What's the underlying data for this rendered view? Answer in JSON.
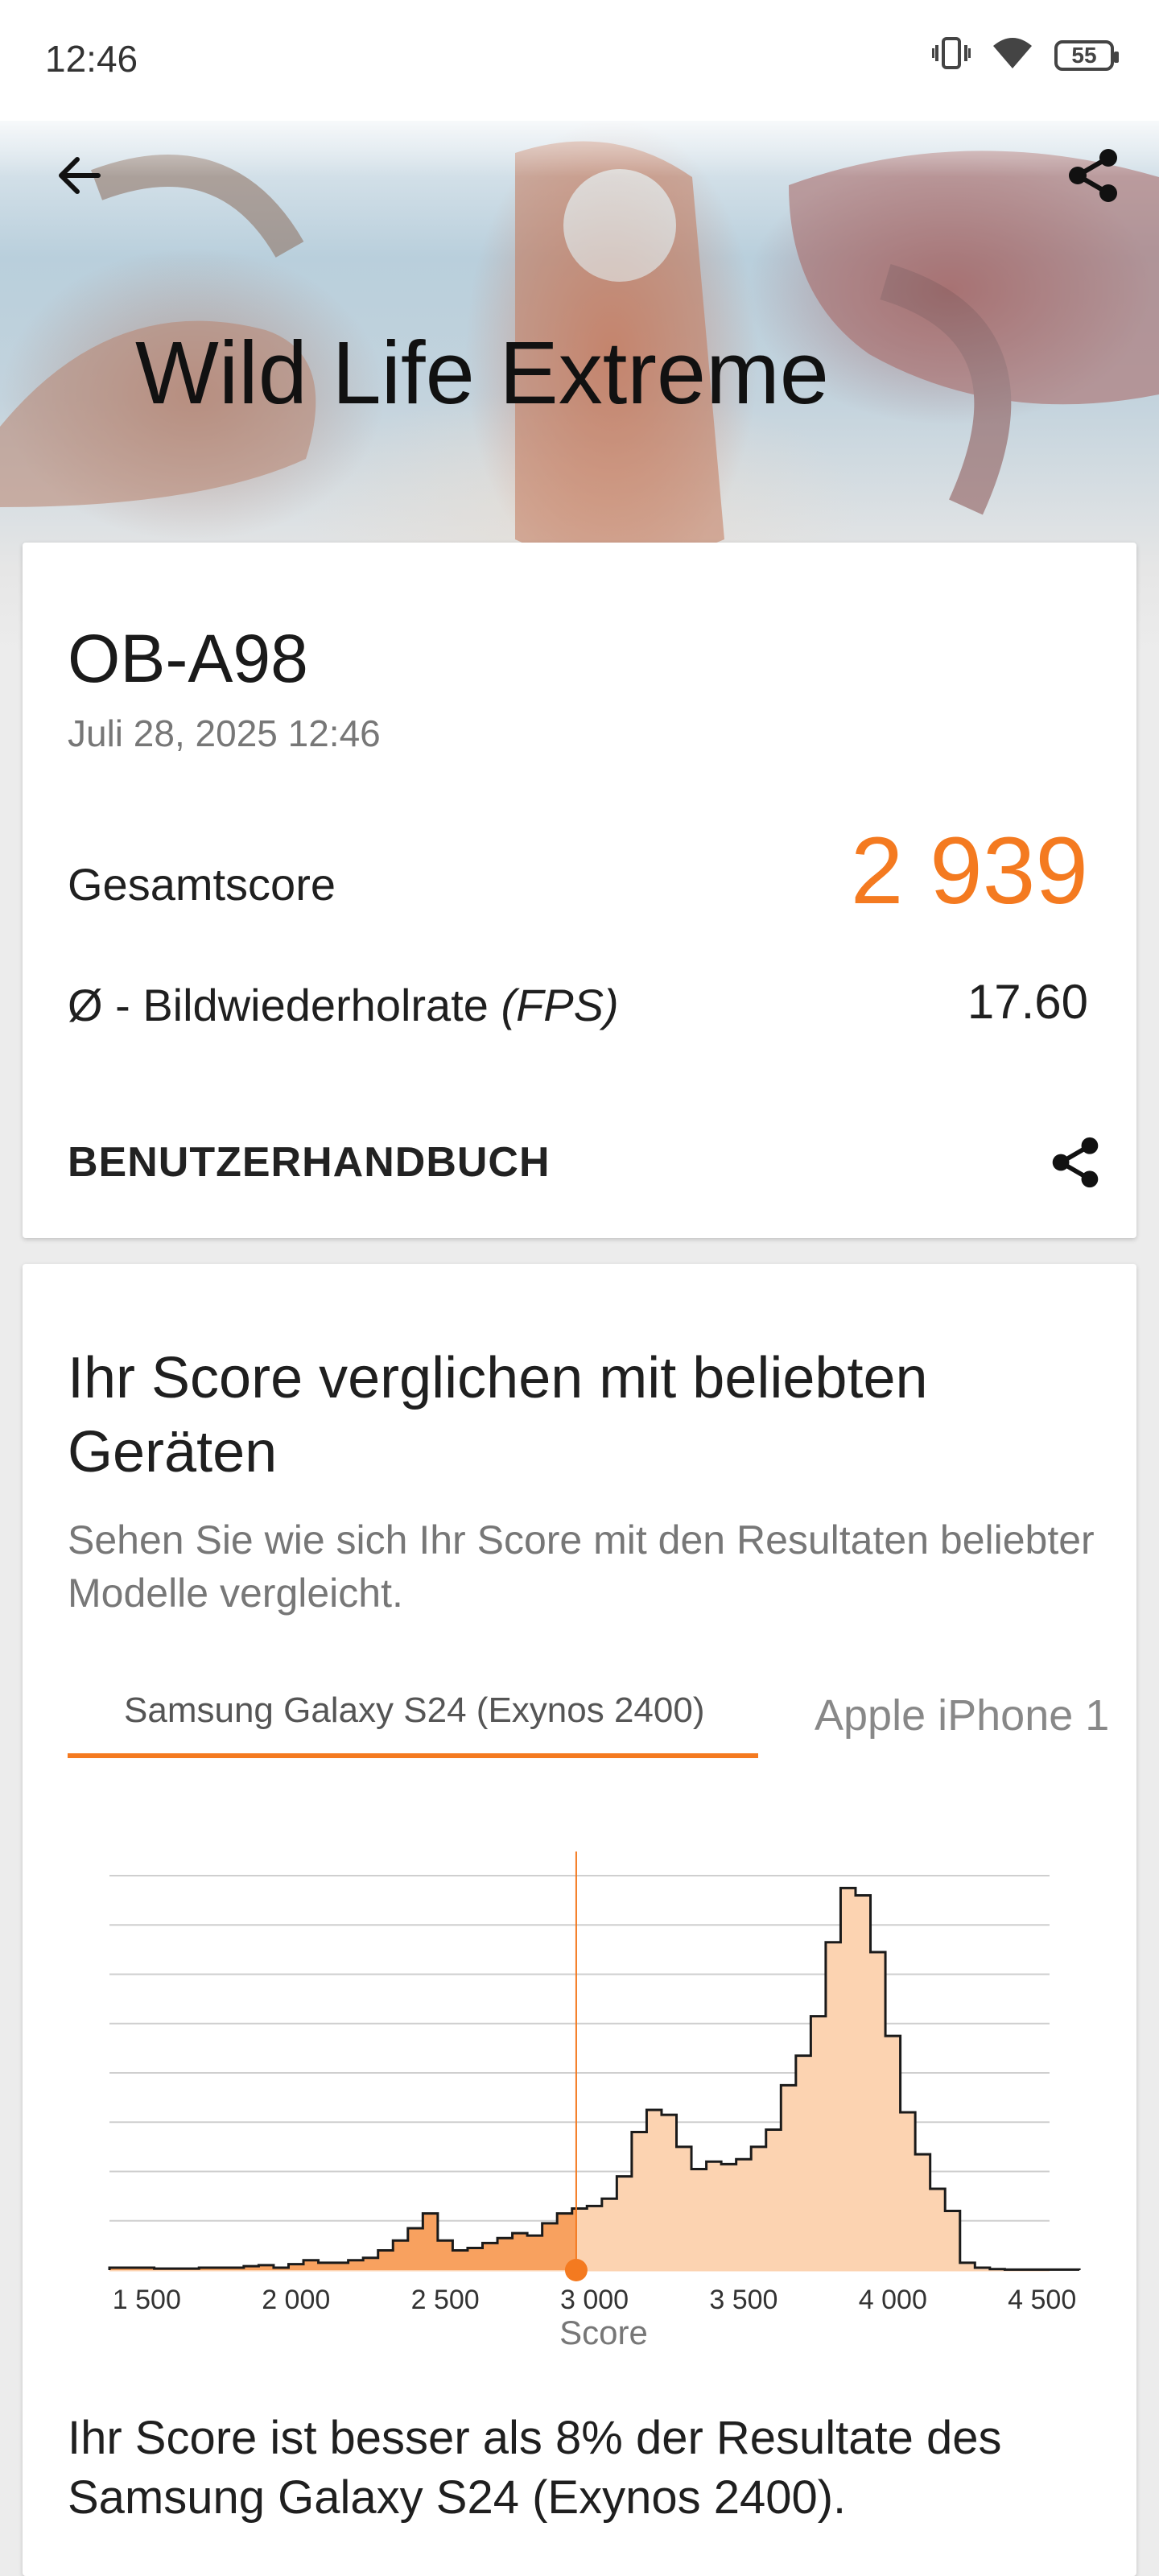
{
  "status_bar": {
    "time": "12:46",
    "battery": "55",
    "icons": [
      "vibrate-icon",
      "wifi-icon",
      "battery-icon"
    ]
  },
  "header": {
    "title": "Wild Life Extreme",
    "back_icon": "arrow-left-icon",
    "share_icon": "share-icon"
  },
  "result": {
    "device": "OB-A98",
    "date": "Juli 28, 2025 12:46",
    "total_label": "Gesamtscore",
    "total_value": "2 939",
    "fps_label_prefix": "Ø - Bildwiederholrate ",
    "fps_label_unit": "(FPS)",
    "fps_value": "17.60",
    "manual_label": "BENUTZERHANDBUCH"
  },
  "comparison": {
    "title": "Ihr Score verglichen mit beliebten Geräten",
    "subtitle": "Sehen Sie wie sich Ihr Score mit den Resultaten beliebter Modelle vergleicht.",
    "tabs": [
      "Samsung Galaxy S24 (Exynos 2400)",
      "Apple iPhone 1"
    ],
    "selected_tab": 0,
    "result_text": "Ihr Score ist besser als 8% der Resultate des Samsung Galaxy S24 (Exynos 2400)."
  },
  "colors": {
    "accent": "#f47a20",
    "fill_light": "#fcd3b1",
    "fill_dark": "#f8a15f"
  },
  "chart_data": {
    "type": "area",
    "xlabel": "Score",
    "ylabel": "",
    "xlim": [
      1375,
      4525
    ],
    "ylim": [
      0,
      8
    ],
    "grid": true,
    "x_ticks": [
      1500,
      2000,
      2500,
      3000,
      3500,
      4000,
      4500
    ],
    "x_tick_labels": [
      "1 500",
      "2 000",
      "2 500",
      "3 000",
      "3 500",
      "4 000",
      "4 500"
    ],
    "marker": 2939,
    "x": [
      1375,
      1525,
      1675,
      1825,
      1875,
      1925,
      1975,
      2025,
      2075,
      2125,
      2175,
      2225,
      2275,
      2325,
      2375,
      2425,
      2475,
      2525,
      2575,
      2625,
      2675,
      2725,
      2775,
      2825,
      2875,
      2925,
      2975,
      3025,
      3075,
      3125,
      3175,
      3225,
      3275,
      3325,
      3375,
      3425,
      3475,
      3525,
      3575,
      3625,
      3675,
      3725,
      3775,
      3825,
      3875,
      3925,
      3975,
      4025,
      4075,
      4125,
      4175,
      4225,
      4275,
      4325,
      4375,
      4425,
      4475
    ],
    "values": [
      0.05,
      0.03,
      0.05,
      0.08,
      0.1,
      0.05,
      0.12,
      0.2,
      0.15,
      0.15,
      0.2,
      0.25,
      0.4,
      0.6,
      0.85,
      1.15,
      0.6,
      0.4,
      0.45,
      0.55,
      0.65,
      0.75,
      0.7,
      0.95,
      1.15,
      1.25,
      1.3,
      1.45,
      1.9,
      2.8,
      3.25,
      3.15,
      2.5,
      2.05,
      2.2,
      2.15,
      2.25,
      2.5,
      2.85,
      3.75,
      4.35,
      5.15,
      6.65,
      7.75,
      7.6,
      6.45,
      4.75,
      3.2,
      2.35,
      1.65,
      1.2,
      0.15,
      0.05,
      0.02,
      0.01,
      0.01,
      0.01
    ]
  }
}
